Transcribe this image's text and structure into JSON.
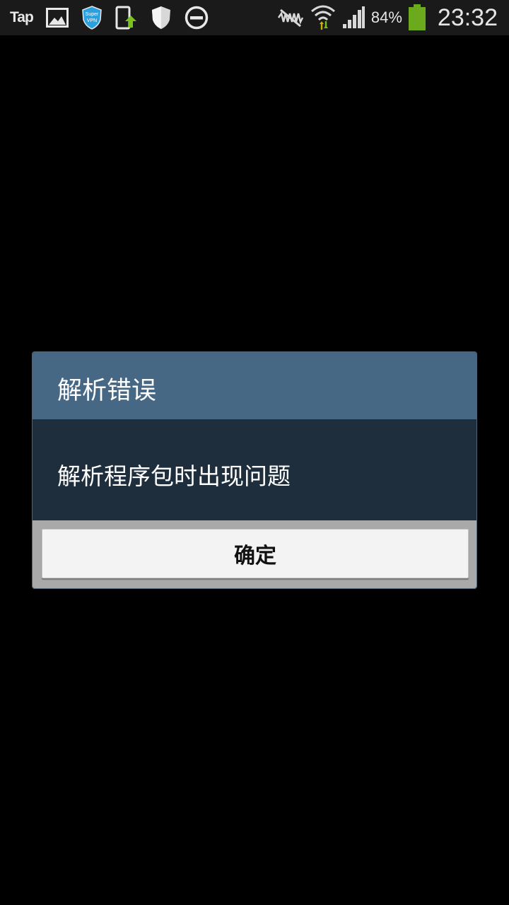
{
  "status_bar": {
    "app_logo": "Tap",
    "icons_left": [
      "image-icon",
      "vpn-shield-icon",
      "phone-upload-icon",
      "shield-icon",
      "do-not-disturb-icon"
    ],
    "icons_right": [
      "silent-mode-icon",
      "wifi-icon",
      "signal-icon"
    ],
    "battery_percent": "84%",
    "battery_level": 0.84,
    "time": "23:32"
  },
  "dialog": {
    "title": "解析错误",
    "message": "解析程序包时出现问题",
    "ok_label": "确定"
  },
  "colors": {
    "header": "#476885",
    "body": "#1f2e3d",
    "footer": "#a9a9a9",
    "battery": "#6aaa1c"
  }
}
